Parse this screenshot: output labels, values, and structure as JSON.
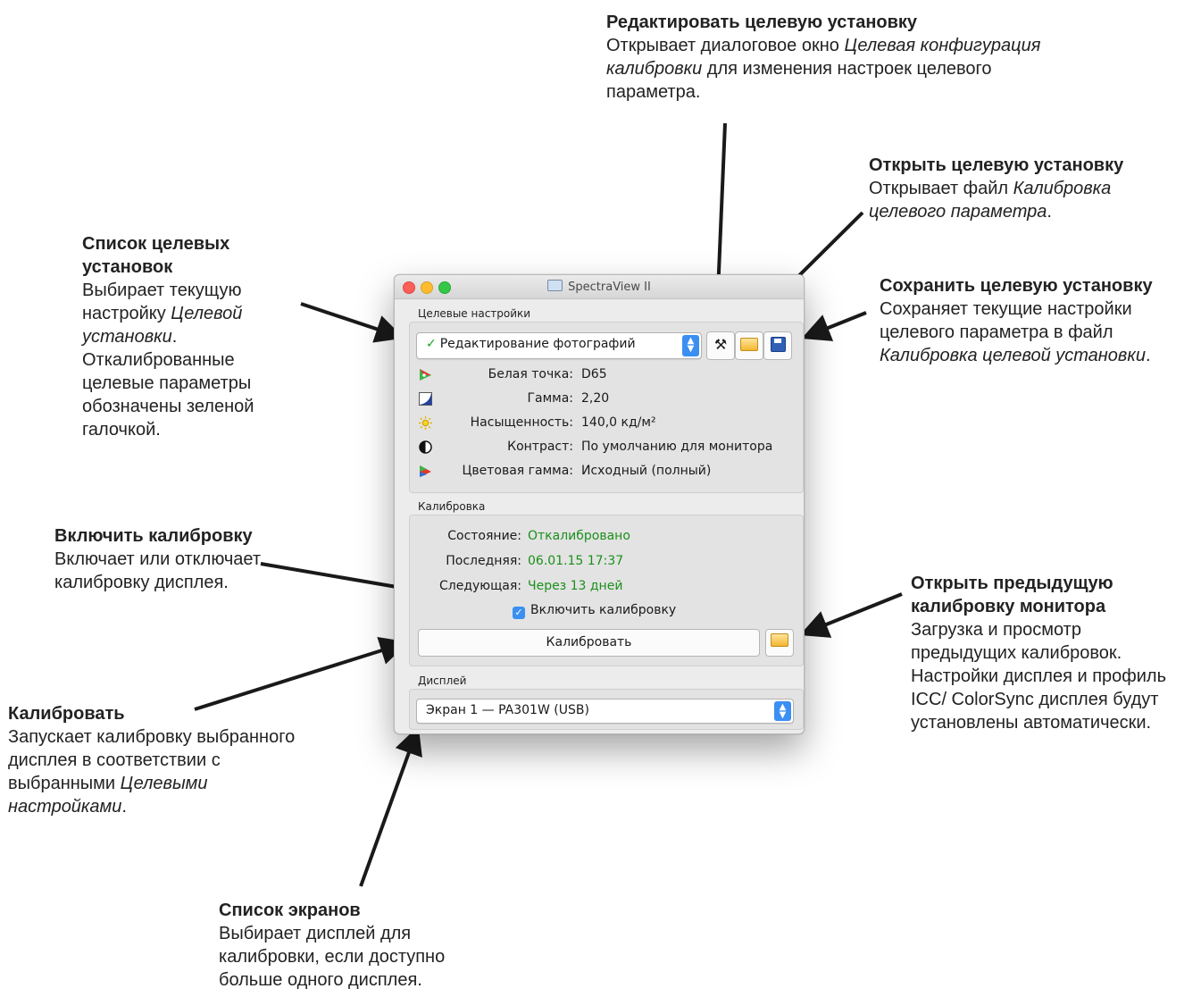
{
  "annotations": {
    "edit_target": {
      "title": "Редактировать целевую установку",
      "text1": "Открывает диалоговое окно ",
      "italic": "Целевая конфигурация калибровки",
      "text2": " для изменения настроек целевого параметра."
    },
    "open_target": {
      "title": "Открыть целевую установку",
      "text1": "Открывает файл ",
      "italic": "Калибровка целевого параметра",
      "text2": "."
    },
    "target_list": {
      "title": "Список целевых установок",
      "text1": "Выбирает текущую настройку ",
      "italic": "Целевой установки",
      "text2": ". Откалиброванные целевые параметры обозначены зеленой галочкой."
    },
    "save_target": {
      "title": "Сохранить целевую установку",
      "text1": "Сохраняет текущие настройки целевого параметра в файл ",
      "italic": "Калибровка целевой установки",
      "text2": "."
    },
    "enable_cal": {
      "title": "Включить калибровку",
      "text": "Включает или отключает калибровку дисплея."
    },
    "open_prev": {
      "title": "Открыть предыдущую калибровку монитора",
      "text": " Загрузка и просмотр предыдущих калибровок. Настройки дисплея и профиль ICC/ ColorSync дисплея будут установлены автоматически."
    },
    "calibrate": {
      "title": "Калибровать",
      "text1": "Запускает калибровку выбранного дисплея в соответствии с выбранными ",
      "italic": "Целевыми настройками",
      "text2": "."
    },
    "screens": {
      "title": "Список экранов",
      "text": "Выбирает дисплей для калибровки, если доступно больше одного дисплея."
    }
  },
  "window": {
    "title": "SpectraView II",
    "targets_section": "Целевые настройки",
    "target_select": "Редактирование фотографий",
    "settings": [
      {
        "icon": "white-point-icon",
        "label": "Белая точка:",
        "value": "D65"
      },
      {
        "icon": "gamma-icon",
        "label": "Гамма:",
        "value": "2,20"
      },
      {
        "icon": "brightness-icon",
        "label": "Насыщенность:",
        "value": "140,0 кд/м²"
      },
      {
        "icon": "contrast-icon",
        "label": "Контраст:",
        "value": "По умолчанию для монитора"
      },
      {
        "icon": "color-gamut-icon",
        "label": "Цветовая гамма:",
        "value": "Исходный (полный)"
      }
    ],
    "calibration_section": "Калибровка",
    "calibration": [
      {
        "label": "Состояние:",
        "value": "Откалибровано"
      },
      {
        "label": "Последняя:",
        "value": "06.01.15 17:37"
      },
      {
        "label": "Следующая:",
        "value": "Через 13 дней"
      }
    ],
    "enable_checkbox": "Включить калибровку",
    "calibrate_button": "Калибровать",
    "display_section": "Дисплей",
    "display_select": "Экран 1 — PA301W (USB)"
  },
  "colors": {
    "accent": "#3b8ff2",
    "status_green": "#1b8f1b"
  }
}
